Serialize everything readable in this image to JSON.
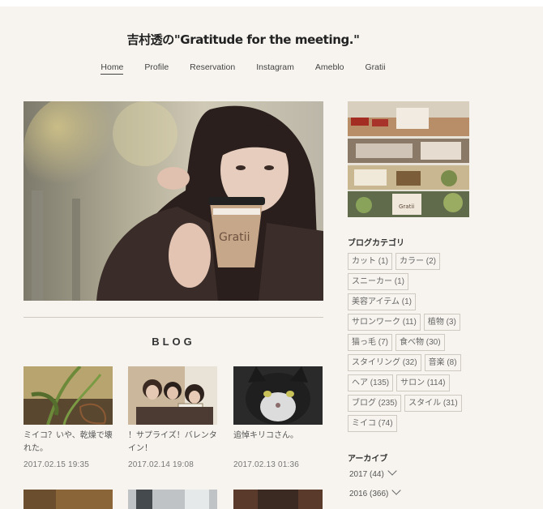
{
  "site": {
    "title": "吉村透の\"Gratitude for the meeting.\""
  },
  "nav": [
    {
      "label": "Home",
      "active": true
    },
    {
      "label": "Profile"
    },
    {
      "label": "Reservation"
    },
    {
      "label": "Instagram"
    },
    {
      "label": "Ameblo"
    },
    {
      "label": "Gratii"
    }
  ],
  "hero": {
    "cup_text": "Gratii"
  },
  "blog": {
    "heading": "BLOG",
    "posts": [
      {
        "title": "ミイコ？いや、乾燥で壊れた。",
        "date": "2017.02.15 19:35"
      },
      {
        "title": "！サプライズ！バレンタイン！",
        "date": "2017.02.14 19:08"
      },
      {
        "title": "追悼キリコさん。",
        "date": "2017.02.13 01:36"
      }
    ]
  },
  "sidebar": {
    "category_heading": "ブログカテゴリ",
    "categories": [
      "カット (1)",
      "カラー (2)",
      "スニーカー (1)",
      "美容アイテム (1)",
      "サロンワーク (11)",
      "植物 (3)",
      "猫っ毛 (7)",
      "食べ物 (30)",
      "スタイリング (32)",
      "音楽 (8)",
      "ヘア (135)",
      "サロン (114)",
      "ブログ (235)",
      "スタイル (31)",
      "ミイコ (74)"
    ],
    "archive_heading": "アーカイブ",
    "archives": [
      "2017 (44)",
      "2016 (366)"
    ]
  }
}
